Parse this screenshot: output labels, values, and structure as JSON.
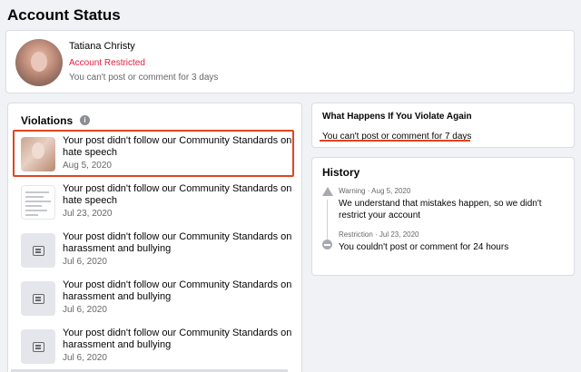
{
  "page": {
    "title": "Account Status"
  },
  "profile": {
    "name": "Tatiana Christy",
    "status": "Account Restricted",
    "note": "You can't post or comment for 3 days"
  },
  "violations": {
    "title": "Violations",
    "info_icon": "i",
    "items": [
      {
        "text": "Your post didn't follow our Community Standards on hate speech",
        "date": "Aug 5, 2020",
        "thumb": "photo"
      },
      {
        "text": "Your post didn't follow our Community Standards on hate speech",
        "date": "Jul 23, 2020",
        "thumb": "document"
      },
      {
        "text": "Your post didn't follow our Community Standards on harassment and bullying",
        "date": "Jul 6, 2020",
        "thumb": "post-icon"
      },
      {
        "text": "Your post didn't follow our Community Standards on harassment and bullying",
        "date": "Jul 6, 2020",
        "thumb": "post-icon"
      },
      {
        "text": "Your post didn't follow our Community Standards on harassment and bullying",
        "date": "Jul 6, 2020",
        "thumb": "post-icon"
      }
    ]
  },
  "what_happens": {
    "title": "What Happens If You Violate Again",
    "text": "You can't post or comment for 7 days"
  },
  "history": {
    "title": "History",
    "items": [
      {
        "type": "Warning",
        "meta": "Warning · Aug 5, 2020",
        "text": "We understand that mistakes happen, so we didn't restrict your account",
        "icon": "warning-icon"
      },
      {
        "type": "Restriction",
        "meta": "Restriction · Jul 23, 2020",
        "text": "You couldn't post or comment for 24 hours",
        "icon": "restriction-icon"
      }
    ]
  },
  "colors": {
    "accent_red": "#e41e3f",
    "annotation_red": "#e0451f",
    "background": "#f0f2f5"
  }
}
